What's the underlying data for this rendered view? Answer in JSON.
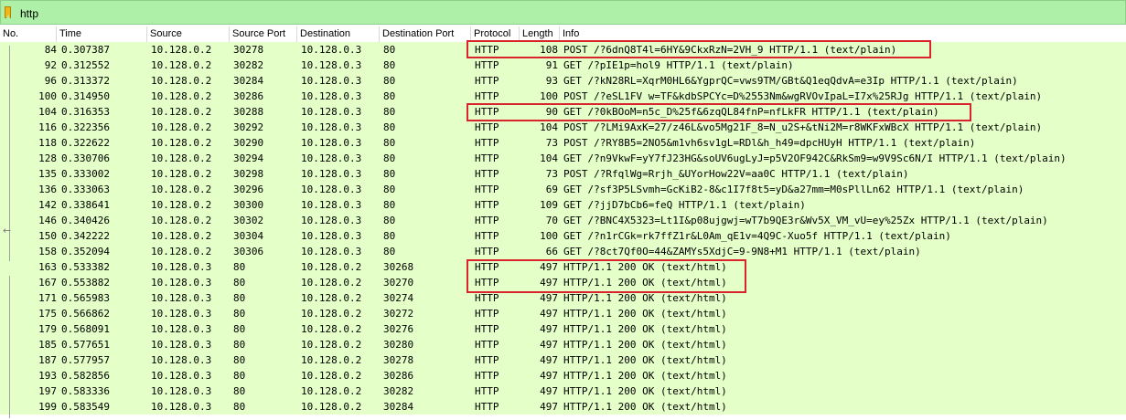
{
  "filter": {
    "text": "http"
  },
  "columns": {
    "no": "No.",
    "time": "Time",
    "source": "Source",
    "source_port": "Source Port",
    "destination": "Destination",
    "destination_port": "Destination Port",
    "protocol": "Protocol",
    "length": "Length",
    "info": "Info"
  },
  "rows": [
    {
      "no": "84",
      "time": "0.307387",
      "src": "10.128.0.2",
      "sport": "30278",
      "dst": "10.128.0.3",
      "dport": "80",
      "proto": "HTTP",
      "len": "108",
      "info": "POST /?6dnQ8T4l=6HY&9CkxRzN=2VH_9 HTTP/1.1  (text/plain)"
    },
    {
      "no": "92",
      "time": "0.312552",
      "src": "10.128.0.2",
      "sport": "30282",
      "dst": "10.128.0.3",
      "dport": "80",
      "proto": "HTTP",
      "len": "91",
      "info": "GET /?pIE1p=hol9 HTTP/1.1  (text/plain)"
    },
    {
      "no": "96",
      "time": "0.313372",
      "src": "10.128.0.2",
      "sport": "30284",
      "dst": "10.128.0.3",
      "dport": "80",
      "proto": "HTTP",
      "len": "93",
      "info": "GET /?kN28RL=XqrM0HL6&YgprQC=vws9TM/GBt&Q1eqQdvA=e3Ip HTTP/1.1  (text/plain)"
    },
    {
      "no": "100",
      "time": "0.314950",
      "src": "10.128.0.2",
      "sport": "30286",
      "dst": "10.128.0.3",
      "dport": "80",
      "proto": "HTTP",
      "len": "100",
      "info": "POST /?eSL1FV w=TF&kdbSPCYc=D%2553Nm&wgRVOvIpaL=I7x%25RJg HTTP/1.1  (text/plain)"
    },
    {
      "no": "104",
      "time": "0.316353",
      "src": "10.128.0.2",
      "sport": "30288",
      "dst": "10.128.0.3",
      "dport": "80",
      "proto": "HTTP",
      "len": "90",
      "info": "GET /?0kBOoM=n5c_D%25f&6zqQL84fnP=nfLkFR HTTP/1.1  (text/plain)"
    },
    {
      "no": "116",
      "time": "0.322356",
      "src": "10.128.0.2",
      "sport": "30292",
      "dst": "10.128.0.3",
      "dport": "80",
      "proto": "HTTP",
      "len": "104",
      "info": "POST /?LMi9AxK=27/z46L&vo5Mg21F_8=N_u2S+&tNi2M=r8WKFxWBcX HTTP/1.1  (text/plain)"
    },
    {
      "no": "118",
      "time": "0.322622",
      "src": "10.128.0.2",
      "sport": "30290",
      "dst": "10.128.0.3",
      "dport": "80",
      "proto": "HTTP",
      "len": "73",
      "info": "POST /?RY8B5=2NO5&m1vh6sv1gL=RDl&h_h49=dpcHUyH HTTP/1.1  (text/plain)"
    },
    {
      "no": "128",
      "time": "0.330706",
      "src": "10.128.0.2",
      "sport": "30294",
      "dst": "10.128.0.3",
      "dport": "80",
      "proto": "HTTP",
      "len": "104",
      "info": "GET /?n9VkwF=yY7fJ23HG&soUV6ugLyJ=p5V2OF942C&RkSm9=w9V9Sc6N/I HTTP/1.1  (text/plain)"
    },
    {
      "no": "135",
      "time": "0.333002",
      "src": "10.128.0.2",
      "sport": "30298",
      "dst": "10.128.0.3",
      "dport": "80",
      "proto": "HTTP",
      "len": "73",
      "info": "POST /?RfqlWg=Rrjh_&UYorHow22V=aa0C HTTP/1.1  (text/plain)"
    },
    {
      "no": "136",
      "time": "0.333063",
      "src": "10.128.0.2",
      "sport": "30296",
      "dst": "10.128.0.3",
      "dport": "80",
      "proto": "HTTP",
      "len": "69",
      "info": "GET /?sf3P5LSvmh=GcKiB2-8&c1I7f8t5=yD&a27mm=M0sPllLn62 HTTP/1.1  (text/plain)"
    },
    {
      "no": "142",
      "time": "0.338641",
      "src": "10.128.0.2",
      "sport": "30300",
      "dst": "10.128.0.3",
      "dport": "80",
      "proto": "HTTP",
      "len": "109",
      "info": "GET /?jjD7bCb6=feQ HTTP/1.1  (text/plain)"
    },
    {
      "no": "146",
      "time": "0.340426",
      "src": "10.128.0.2",
      "sport": "30302",
      "dst": "10.128.0.3",
      "dport": "80",
      "proto": "HTTP",
      "len": "70",
      "info": "GET /?BNC4X5323=Lt1I&p08ujgwj=wT7b9QE3r&Wv5X_VM_vU=ey%25Zx HTTP/1.1  (text/plain)"
    },
    {
      "no": "150",
      "time": "0.342222",
      "src": "10.128.0.2",
      "sport": "30304",
      "dst": "10.128.0.3",
      "dport": "80",
      "proto": "HTTP",
      "len": "100",
      "info": "GET /?n1rCGk=rk7ffZ1r&L0Am_qE1v=4Q9C-Xuo5f HTTP/1.1  (text/plain)"
    },
    {
      "no": "158",
      "time": "0.352094",
      "src": "10.128.0.2",
      "sport": "30306",
      "dst": "10.128.0.3",
      "dport": "80",
      "proto": "HTTP",
      "len": "66",
      "info": "GET /?8ct7Qf0O=44&ZAMYs5XdjC=9-9N8+M1 HTTP/1.1  (text/plain)"
    },
    {
      "no": "163",
      "time": "0.533382",
      "src": "10.128.0.3",
      "sport": "80",
      "dst": "10.128.0.2",
      "dport": "30268",
      "proto": "HTTP",
      "len": "497",
      "info": "HTTP/1.1 200 OK  (text/html)"
    },
    {
      "no": "167",
      "time": "0.553882",
      "src": "10.128.0.3",
      "sport": "80",
      "dst": "10.128.0.2",
      "dport": "30270",
      "proto": "HTTP",
      "len": "497",
      "info": "HTTP/1.1 200 OK  (text/html)"
    },
    {
      "no": "171",
      "time": "0.565983",
      "src": "10.128.0.3",
      "sport": "80",
      "dst": "10.128.0.2",
      "dport": "30274",
      "proto": "HTTP",
      "len": "497",
      "info": "HTTP/1.1 200 OK  (text/html)"
    },
    {
      "no": "175",
      "time": "0.566862",
      "src": "10.128.0.3",
      "sport": "80",
      "dst": "10.128.0.2",
      "dport": "30272",
      "proto": "HTTP",
      "len": "497",
      "info": "HTTP/1.1 200 OK  (text/html)"
    },
    {
      "no": "179",
      "time": "0.568091",
      "src": "10.128.0.3",
      "sport": "80",
      "dst": "10.128.0.2",
      "dport": "30276",
      "proto": "HTTP",
      "len": "497",
      "info": "HTTP/1.1 200 OK  (text/html)"
    },
    {
      "no": "185",
      "time": "0.577651",
      "src": "10.128.0.3",
      "sport": "80",
      "dst": "10.128.0.2",
      "dport": "30280",
      "proto": "HTTP",
      "len": "497",
      "info": "HTTP/1.1 200 OK  (text/html)"
    },
    {
      "no": "187",
      "time": "0.577957",
      "src": "10.128.0.3",
      "sport": "80",
      "dst": "10.128.0.2",
      "dport": "30278",
      "proto": "HTTP",
      "len": "497",
      "info": "HTTP/1.1 200 OK  (text/html)"
    },
    {
      "no": "193",
      "time": "0.582856",
      "src": "10.128.0.3",
      "sport": "80",
      "dst": "10.128.0.2",
      "dport": "30286",
      "proto": "HTTP",
      "len": "497",
      "info": "HTTP/1.1 200 OK  (text/html)"
    },
    {
      "no": "197",
      "time": "0.583336",
      "src": "10.128.0.3",
      "sport": "80",
      "dst": "10.128.0.2",
      "dport": "30282",
      "proto": "HTTP",
      "len": "497",
      "info": "HTTP/1.1 200 OK  (text/html)"
    },
    {
      "no": "199",
      "time": "0.583549",
      "src": "10.128.0.3",
      "sport": "80",
      "dst": "10.128.0.2",
      "dport": "30284",
      "proto": "HTTP",
      "len": "497",
      "info": "HTTP/1.1 200 OK  (text/html)"
    }
  ],
  "colors": {
    "row_background": "#e4ffc7",
    "filter_background": "#aef0a8",
    "highlight": "#d9232d"
  }
}
